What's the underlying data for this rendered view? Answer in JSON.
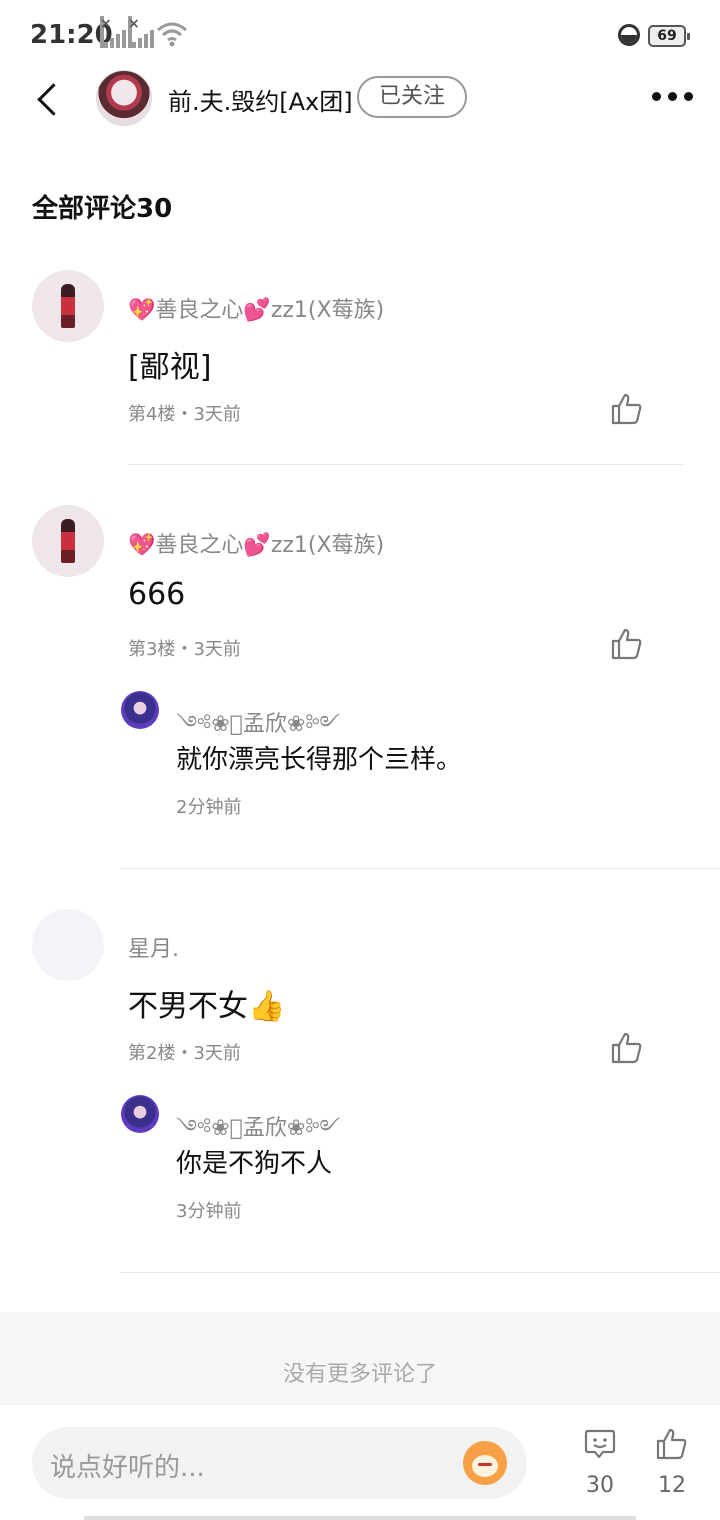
{
  "status_bar": {
    "time": "21:20",
    "battery": "69"
  },
  "header": {
    "user_name": "前.夫.毁约[Ax团]",
    "follow_label": "已关注"
  },
  "section_title": "全部评论30",
  "comments": [
    {
      "author_prefix": "💖",
      "author_name": "善良之心",
      "author_mid": "💕",
      "author_suffix": "zz1(X莓族)",
      "text": "[鄙视]",
      "meta": "第4楼・3天前"
    },
    {
      "author_prefix": "💖",
      "author_name": "善良之心",
      "author_mid": "💕",
      "author_suffix": "zz1(X莓族)",
      "text": "666",
      "meta": "第3楼・3天前",
      "reply": {
        "author": "༺❀ུ孟欣❀༻",
        "text": "就你漂亮长得那个亖样。",
        "meta": "2分钟前"
      }
    },
    {
      "author_name": "星月.",
      "text": "不男不女👍",
      "meta": "第2楼・3天前",
      "reply": {
        "author": "༺❀ུ孟欣❀༻",
        "text": "你是不狗不人",
        "meta": "3分钟前"
      }
    }
  ],
  "no_more": "没有更多评论了",
  "bottom_bar": {
    "input_placeholder": "说点好听的...",
    "comment_count": "30",
    "like_count": "12"
  }
}
